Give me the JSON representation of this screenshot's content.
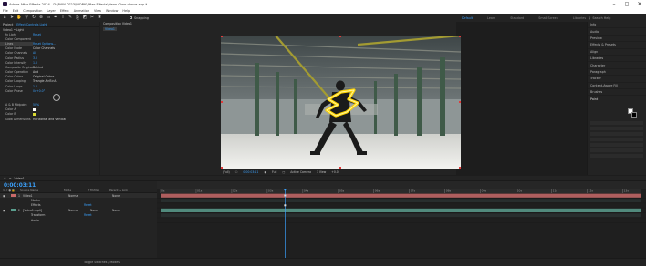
{
  "window": {
    "title": "Adobe After Effects 2024 - D:\\RAW 2023\\WORK\\After Effects\\Neon Glow dance.aep *",
    "controls": [
      "–",
      "◻",
      "✕"
    ]
  },
  "menu": [
    "File",
    "Edit",
    "Composition",
    "Layer",
    "Effect",
    "Animation",
    "View",
    "Window",
    "Help"
  ],
  "toolbar": {
    "tools": [
      "home-icon",
      "selection-icon",
      "hand-icon",
      "zoom-icon",
      "orbit-icon",
      "pan-behind-icon",
      "rectangle-icon",
      "pen-icon",
      "type-icon",
      "brush-icon",
      "clone-icon",
      "eraser-icon",
      "roto-icon",
      "puppet-icon"
    ],
    "snapping_label": "Snapping",
    "workspaces": [
      "Default",
      "Learn",
      "Standard",
      "Small Screen",
      "Libraries"
    ],
    "active_workspace": "Default",
    "search_placeholder": "Search Help"
  },
  "left_panel": {
    "tabs": [
      "Project",
      "Effect Controls Light"
    ],
    "header": "Video1 • Light",
    "rows": [
      {
        "label": "fx  Light",
        "value": "Reset"
      },
      {
        "label": "Color Component",
        "value": ""
      },
      {
        "label": "Lines",
        "value": "Reset   Options..."
      },
      {
        "label": "Color Mode",
        "value": "Color Channels"
      },
      {
        "label": "Color Channels",
        "value": "All"
      },
      {
        "label": "Color Radius",
        "value": "3.0"
      },
      {
        "label": "Color Intensity",
        "value": "1.0"
      },
      {
        "label": "Composite Original",
        "value": "Behind"
      },
      {
        "label": "Color Operation",
        "value": "Add"
      },
      {
        "label": "Color Colors",
        "value": "Original Colors"
      },
      {
        "label": "Color Looping",
        "value": "Triangle A>B>A"
      },
      {
        "label": "Color Loops",
        "value": "1.0"
      },
      {
        "label": "Color Phase",
        "value": "0x+0.0°"
      },
      {
        "label": "A & B Midpoint",
        "value": "50%"
      },
      {
        "label": "Color A",
        "value": ""
      },
      {
        "label": "Color B",
        "value": ""
      },
      {
        "label": "Glow Dimensions",
        "value": "Horizontal and Vertical"
      }
    ]
  },
  "composition": {
    "tab": "Composition Video1",
    "subtab": "Video1",
    "footer": {
      "zoom": "(Full)",
      "timecode": "0:00:03:11",
      "quality": "Full",
      "camera": "Active Camera",
      "views": "1 View",
      "offset": "+0.0"
    }
  },
  "right_panel": {
    "items": [
      "Info",
      "Audio",
      "Preview",
      "Effects & Presets",
      "Align",
      "Libraries",
      "Character",
      "Paragraph",
      "Tracker",
      "Content-Aware Fill",
      "Brushes",
      "Paint"
    ]
  },
  "timeline": {
    "tab": "Video1",
    "timecode": "0:00:03:11",
    "columns": [
      "Source Name",
      "Mode",
      "T TrkMat",
      "Parent & Link"
    ],
    "layers": [
      {
        "num": "1",
        "name": "Video1",
        "mode": "Normal",
        "parent": "None",
        "color": "#c96a6a"
      },
      {
        "num": "",
        "name": "Masks",
        "mode": "",
        "parent": "",
        "color": ""
      },
      {
        "num": "",
        "name": "Effects",
        "mode": "Reset",
        "parent": "",
        "color": ""
      },
      {
        "num": "2",
        "name": "[Video1.mp4]",
        "mode": "Normal",
        "trkmat": "None",
        "parent": "None",
        "color": "#5a9e8e"
      },
      {
        "num": "",
        "name": "Transform",
        "mode": "Reset",
        "parent": "",
        "color": ""
      },
      {
        "num": "",
        "name": "Audio",
        "mode": "",
        "parent": "",
        "color": ""
      }
    ],
    "ruler": [
      "0s",
      "01s",
      "02s",
      "03s",
      "04s",
      "05s",
      "06s",
      "07s",
      "08s",
      "09s",
      "10s",
      "11s",
      "12s",
      "13s"
    ],
    "playhead_seconds": 3.5,
    "total_seconds": 13.5
  },
  "status": {
    "toggle_label": "Toggle Switches / Modes"
  }
}
